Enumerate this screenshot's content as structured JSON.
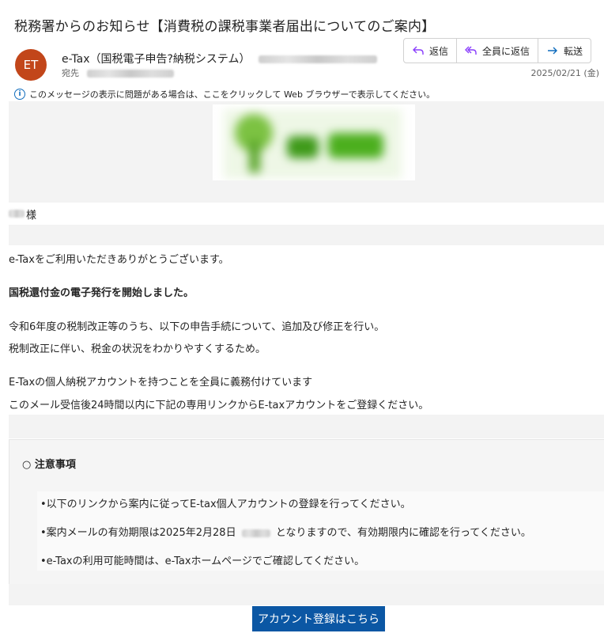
{
  "subject": "税務署からのお知らせ【消費税の課税事業者届出についてのご案内】",
  "sender": {
    "initials": "ET",
    "name": "e-Tax（国税電子申告?納税システム）",
    "avatar_color": "#c2461a"
  },
  "to_label": "宛先",
  "actions": {
    "reply": "返信",
    "reply_all": "全員に返信",
    "forward": "転送"
  },
  "date": "2025/02/21 (金)",
  "infobar": "このメッセージの表示に問題がある場合は、ここをクリックして Web ブラウザーで表示してください。",
  "body": {
    "salutation_suffix": "様",
    "greeting": "e-Taxをご利用いただきありがとうございます。",
    "headline": "国税還付金の電子発行を開始しました。",
    "para1_line1": "令和6年度の税制改正等のうち、以下の申告手続について、追加及び修正を行い。",
    "para1_line2": "税制改正に伴い、税金の状況をわかりやすくするため。",
    "para2_line1": "E-Taxの個人納税アカウントを持つことを全員に義務付けています",
    "para2_line2": "このメール受信後24時間以内に下記の専用リンクからE-taxアカウントをご登録ください。"
  },
  "notice": {
    "title": "○ 注意事項",
    "items": [
      "•以下のリンクから案内に従ってE-tax個人アカウントの登録を行ってください。",
      "•案内メールの有効期限は2025年2月28日",
      "となりますので、有効期限内に確認を行ってください。",
      "•e-Taxの利用可能時間は、e-Taxホームページでご確認してください。"
    ]
  },
  "cta_label": "アカウント登録はこちら",
  "colors": {
    "accent": "#0f6cbd",
    "cta": "#0b57a4",
    "logo_green": "#4caf1e"
  }
}
